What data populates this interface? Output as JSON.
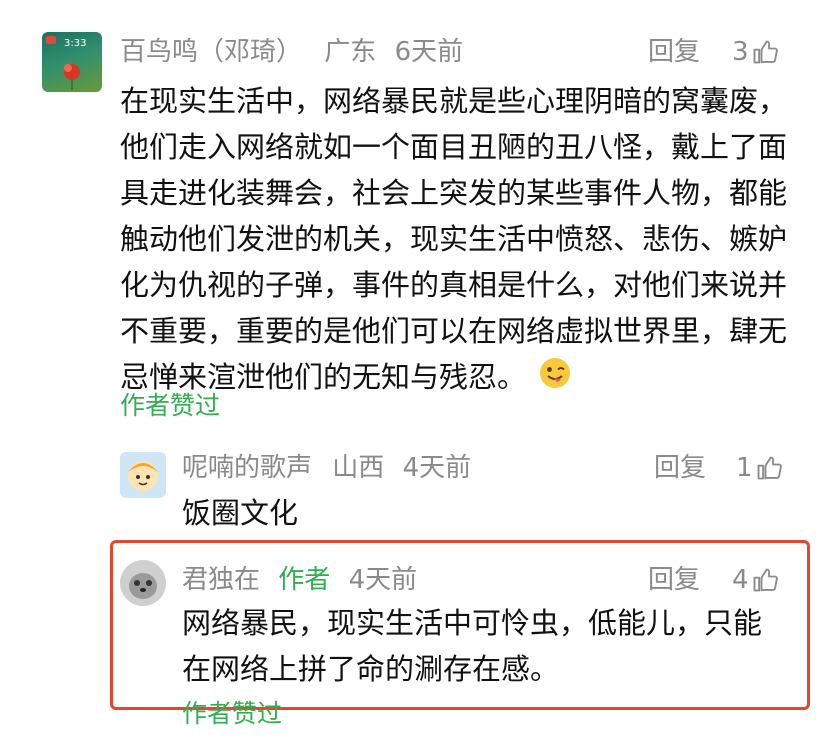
{
  "comments": [
    {
      "username": "百鸟鸣（邓琦）",
      "location": "广东",
      "time": "6天前",
      "reply_label": "回复",
      "likes": "3",
      "text": "在现实生活中，网络暴民就是些心理阴暗的窝囊废，他们走入网络就如一个面目丑陋的丑八怪，戴上了面具走进化装舞会，社会上突发的某些事件人物，都能触动他们发泄的机关，现实生活中愤怒、悲伤、嫉妒化为仇视的子弹，事件的真相是什么，对他们来说并不重要，重要的是他们可以在网络虚拟世界里，肆无忌惮来渲泄他们的无知与残忍。",
      "emoji_icon": "winking-face-tongue-icon",
      "author_liked": "作者赞过"
    },
    {
      "username": "呢喃的歌声",
      "location": "山西",
      "time": "4天前",
      "reply_label": "回复",
      "likes": "1",
      "text": "饭圈文化"
    },
    {
      "username": "君独在",
      "author_tag": "作者",
      "time": "4天前",
      "reply_label": "回复",
      "likes": "4",
      "text": "网络暴民，现实生活中可怜虫，低能儿，只能在网络上拼了命的涮存在感。",
      "author_liked": "作者赞过"
    }
  ],
  "colors": {
    "accent_green": "#2fae52",
    "highlight_border": "#e8462b",
    "meta_gray": "#8a8a8a"
  }
}
